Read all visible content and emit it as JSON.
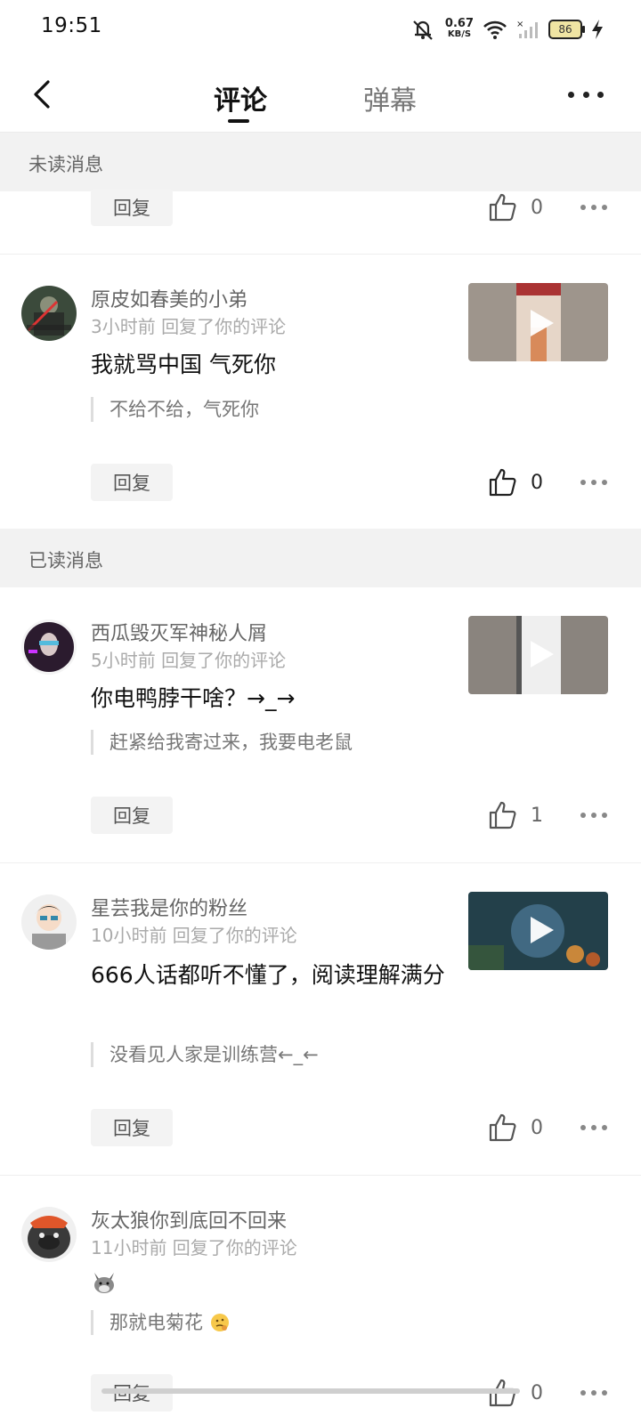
{
  "status": {
    "time": "19:51",
    "speed_value": "0.67",
    "speed_unit": "KB/S",
    "battery": "86"
  },
  "header": {
    "tab_comments": "评论",
    "tab_danmaku": "弹幕"
  },
  "sections": {
    "unread": "未读消息",
    "read": "已读消息"
  },
  "reply_label": "回复",
  "items": [
    {
      "like_count": "0"
    },
    {
      "name": "原皮如春美的小弟",
      "meta": "3小时前 回复了你的评论",
      "comment": "我就骂中国 气死你",
      "quote": "不给不给，气死你",
      "like_count": "0"
    },
    {
      "name": "西瓜毁灭军神秘人屑",
      "meta": "5小时前 回复了你的评论",
      "comment": "你电鸭脖干啥？→_→",
      "quote": "赶紧给我寄过来，我要电老鼠",
      "like_count": "1"
    },
    {
      "name": "星芸我是你的粉丝",
      "meta": "10小时前 回复了你的评论",
      "comment": "666人话都听不懂了，阅读理解满分",
      "quote": "没看见人家是训练营←_←",
      "like_count": "0"
    },
    {
      "name": "灰太狼你到底回不回来",
      "meta": "11小时前 回复了你的评论",
      "comment": "",
      "quote": "那就电菊花",
      "like_count": "0"
    }
  ]
}
